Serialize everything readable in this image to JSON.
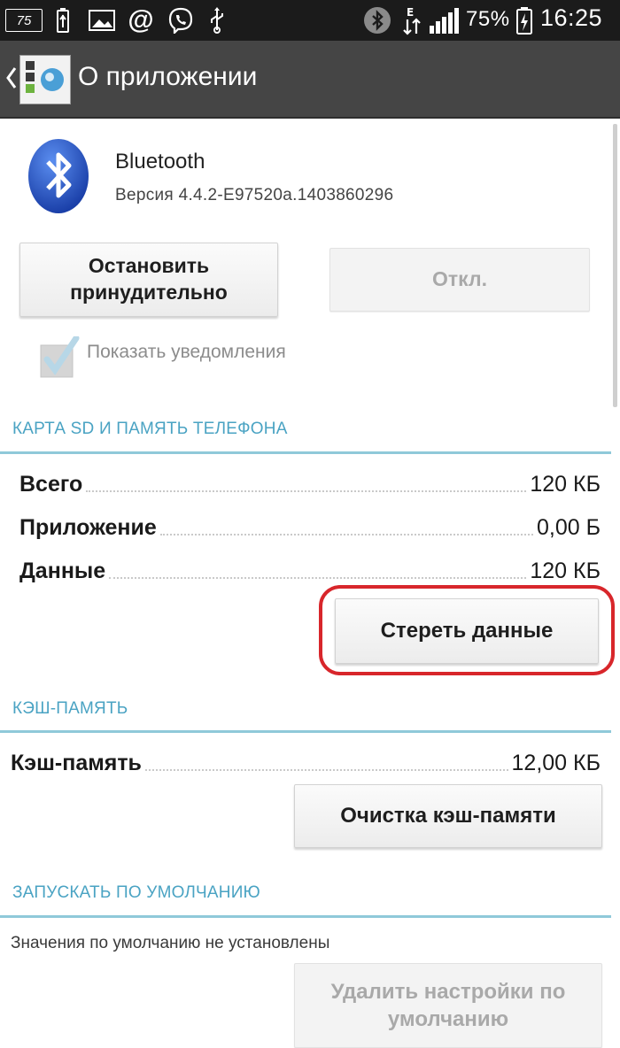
{
  "status_bar": {
    "badge": "75",
    "icons": [
      "usb-battery-icon",
      "image-icon",
      "at-sign-icon",
      "viber-icon",
      "usb-icon",
      "bluetooth-icon",
      "e-data-icon",
      "signal-icon",
      "charging-battery-icon"
    ],
    "battery_percent": "75%",
    "time": "16:25"
  },
  "action_bar": {
    "title": "О приложении"
  },
  "app": {
    "name": "Bluetooth",
    "version": "Версия 4.4.2-E97520a.1403860296"
  },
  "buttons": {
    "force_stop": "Остановить принудительно",
    "disable": "Откл.",
    "clear_data": "Стереть данные",
    "clear_cache": "Очистка кэш-памяти",
    "clear_defaults": "Удалить настройки по умолчанию"
  },
  "notifications": {
    "label": "Показать уведомления",
    "checked": true
  },
  "storage": {
    "header": "КАРТА SD И ПАМЯТЬ ТЕЛЕФОНА",
    "rows": [
      {
        "label": "Всего",
        "value": "120 КБ"
      },
      {
        "label": "Приложение",
        "value": "0,00 Б"
      },
      {
        "label": "Данные",
        "value": "120 КБ"
      }
    ]
  },
  "cache": {
    "header": "КЭШ-ПАМЯТЬ",
    "label": "Кэш-память",
    "value": "12,00 КБ"
  },
  "launch_default": {
    "header": "ЗАПУСКАТЬ ПО УМОЛЧАНИЮ",
    "text": "Значения по умолчанию не установлены"
  },
  "colors": {
    "accent": "#4aa3c3",
    "highlight_ring": "#d8262b",
    "status_bar": "#1b1b1b",
    "action_bar": "#454545"
  }
}
